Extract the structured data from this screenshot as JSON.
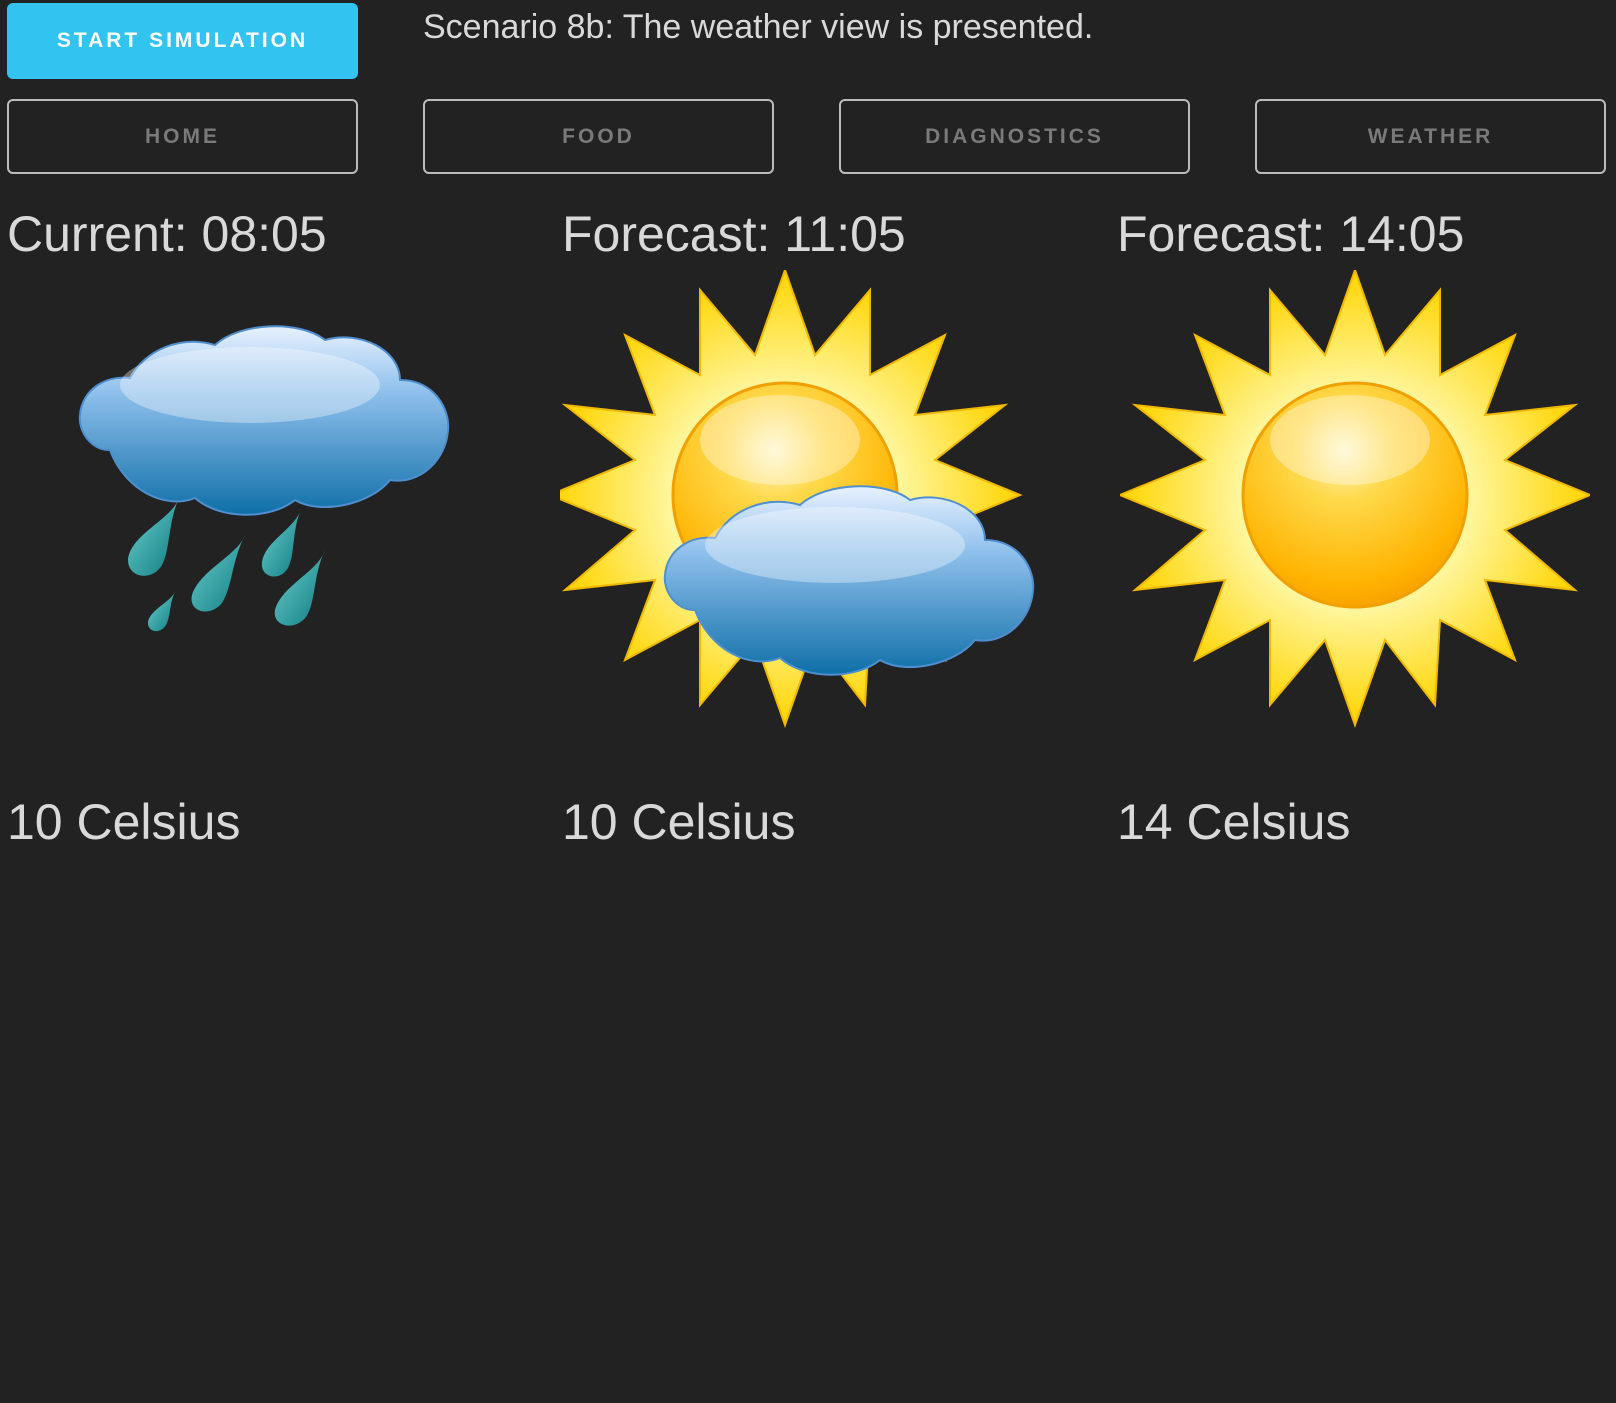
{
  "toolbar": {
    "start_label": "START SIMULATION",
    "scenario_text": "Scenario 8b: The weather view is presented."
  },
  "nav": {
    "items": [
      {
        "label": "HOME"
      },
      {
        "label": "FOOD"
      },
      {
        "label": "DIAGNOSTICS"
      },
      {
        "label": "WEATHER"
      }
    ]
  },
  "weather": {
    "columns": [
      {
        "title": "Current: 08:05",
        "icon": "rain-cloud-icon",
        "temperature": "10 Celsius"
      },
      {
        "title": "Forecast: 11:05",
        "icon": "partly-cloudy-icon",
        "temperature": "10 Celsius"
      },
      {
        "title": "Forecast: 14:05",
        "icon": "sun-icon",
        "temperature": "14 Celsius"
      }
    ]
  },
  "colors": {
    "background": "#222222",
    "accent": "#33c3f0",
    "text": "#d9d9d9"
  }
}
